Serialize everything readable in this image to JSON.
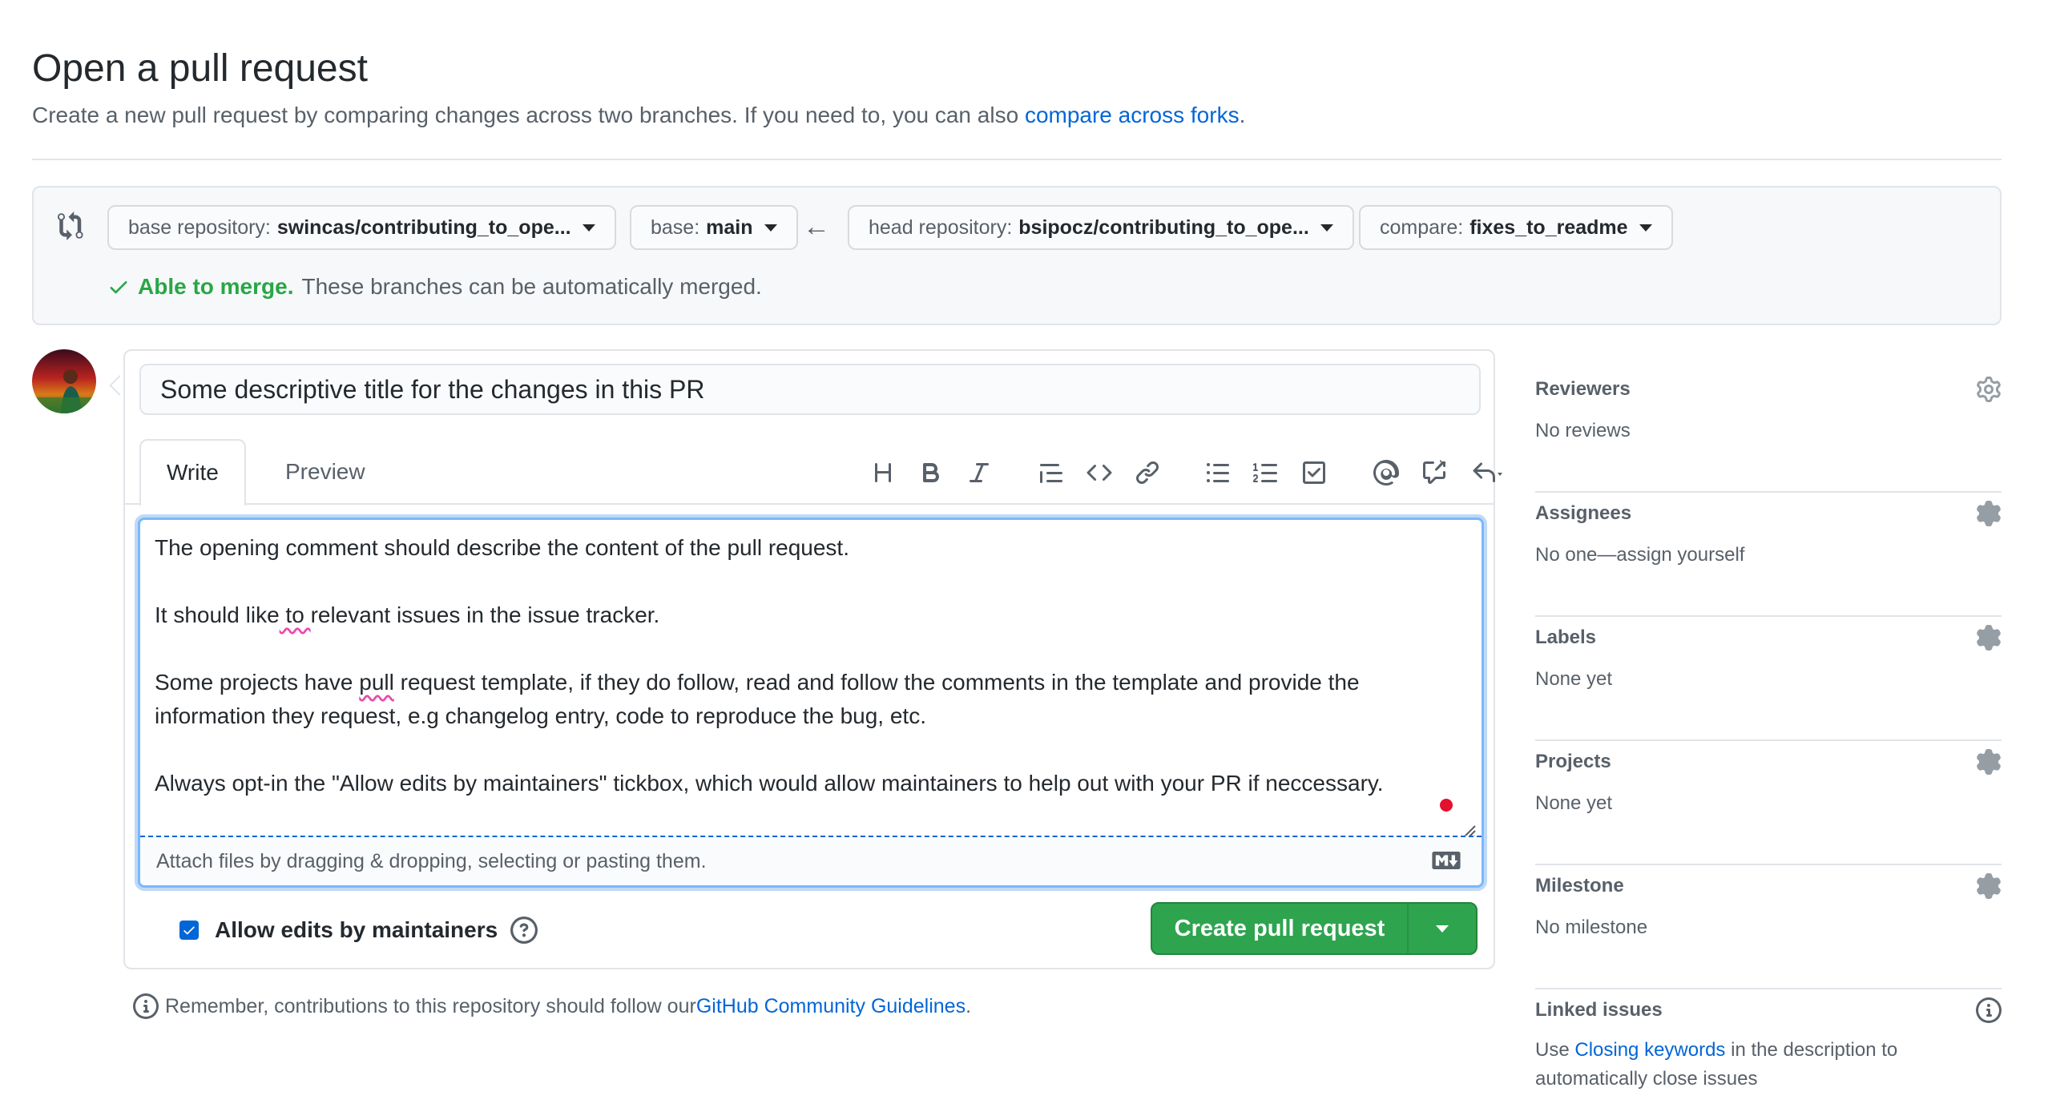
{
  "page": {
    "title": "Open a pull request",
    "subtitle_prefix": "Create a new pull request by comparing changes across two branches. If you need to, you can also ",
    "subtitle_link": "compare across forks",
    "subtitle_suffix": "."
  },
  "compare": {
    "base_repo_label": "base repository:",
    "base_repo_value": "swincas/contributing_to_ope...",
    "base_label": "base:",
    "base_value": "main",
    "head_repo_label": "head repository:",
    "head_repo_value": "bsipocz/contributing_to_ope...",
    "compare_label": "compare:",
    "compare_value": "fixes_to_readme",
    "merge_ok": "Able to merge.",
    "merge_text": "These branches can be automatically merged."
  },
  "form": {
    "title_value": "Some descriptive title for the changes in this PR",
    "tab_write": "Write",
    "tab_preview": "Preview",
    "body_lines": [
      "The opening comment should describe the content of the pull request.",
      "It should like to relevant issues in the issue tracker.",
      "Some projects have pull request template, if they do follow, read and follow the comments in the template and provide the information they request, e.g changelog entry, code to reproduce the bug, etc.",
      "Always opt-in the \"Allow edits by maintainers\" tickbox, which would allow maintainers to help out with your PR if neccessary."
    ],
    "attach_text": "Attach files by dragging & dropping, selecting or pasting them.",
    "allow_edits_label": "Allow edits by maintainers",
    "create_button": "Create pull request"
  },
  "footer": {
    "remember_prefix": "Remember, contributions to this repository should follow our ",
    "remember_link": "GitHub Community Guidelines",
    "remember_suffix": "."
  },
  "sidebar": {
    "reviewers": {
      "title": "Reviewers",
      "value": "No reviews"
    },
    "assignees": {
      "title": "Assignees",
      "value": "No one—assign yourself"
    },
    "labels": {
      "title": "Labels",
      "value": "None yet"
    },
    "projects": {
      "title": "Projects",
      "value": "None yet"
    },
    "milestone": {
      "title": "Milestone",
      "value": "No milestone"
    },
    "linked": {
      "title": "Linked issues",
      "prefix": "Use ",
      "link": "Closing keywords",
      "suffix": " in the description to automatically close issues"
    }
  },
  "colors": {
    "link": "#0366d6",
    "merge_ok": "#28a745",
    "create_button": "#2ea44f",
    "focus_border": "#79b8ff"
  }
}
